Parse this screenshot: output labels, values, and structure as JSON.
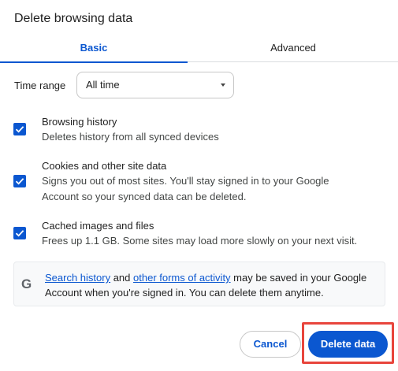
{
  "dialog": {
    "title": "Delete browsing data"
  },
  "tabs": [
    {
      "label": "Basic",
      "selected": true
    },
    {
      "label": "Advanced",
      "selected": false
    }
  ],
  "time_range": {
    "label": "Time range",
    "value": "All time"
  },
  "options": [
    {
      "title": "Browsing history",
      "desc": "Deletes history from all synced devices",
      "checked": true
    },
    {
      "title": "Cookies and other site data",
      "desc": "Signs you out of most sites. You'll stay signed in to your Google Account so your synced data can be deleted.",
      "checked": true
    },
    {
      "title": "Cached images and files",
      "desc": "Frees up 1.1 GB. Some sites may load more slowly on your next visit.",
      "checked": true
    }
  ],
  "info": {
    "icon": "google-g-icon",
    "link1": "Search history",
    "text1": " and ",
    "link2": "other forms of activity",
    "text2": " may be saved in your Google Account when you're signed in. You can delete them anytime."
  },
  "buttons": {
    "cancel": "Cancel",
    "delete": "Delete data"
  },
  "colors": {
    "accent": "#0b57d0",
    "highlight": "#e8453c"
  }
}
